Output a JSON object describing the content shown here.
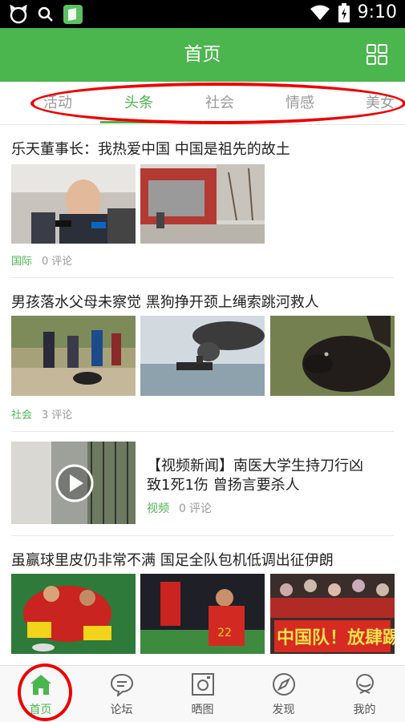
{
  "status_bar": {
    "time": "9:10"
  },
  "app_bar": {
    "title": "首页"
  },
  "tabs": [
    {
      "label": "活动"
    },
    {
      "label": "头条"
    },
    {
      "label": "社会"
    },
    {
      "label": "情感"
    },
    {
      "label": "美女"
    }
  ],
  "feed": [
    {
      "title": "乐天董事长：我热爱中国 中国是祖先的故土",
      "category": "国际",
      "comments": "0",
      "comments_label": "评论"
    },
    {
      "title": "男孩落水父母未察觉 黑狗挣开颈上绳索跳河救人",
      "category": "社会",
      "comments": "3",
      "comments_label": "评论"
    },
    {
      "title_line1": "【视频新闻】南医大学生持刀行凶",
      "title_line2": "致1死1伤 曾扬言要杀人",
      "category": "视频",
      "comments": "0",
      "comments_label": "评论"
    },
    {
      "title": "虽赢球里皮仍非常不满 国足全队包机低调出征伊朗",
      "banner_text": "中国队！放肆踢"
    }
  ],
  "bottom_nav": [
    {
      "label": "首页"
    },
    {
      "label": "论坛"
    },
    {
      "label": "晒图"
    },
    {
      "label": "发现"
    },
    {
      "label": "我的"
    }
  ],
  "colors": {
    "brand": "#4bb64e",
    "annotation": "#e00000"
  }
}
